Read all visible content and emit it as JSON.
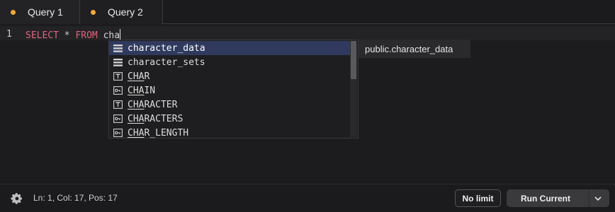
{
  "tabs": [
    {
      "label": "Query 1",
      "unsaved": true,
      "active": true
    },
    {
      "label": "Query 2",
      "unsaved": true,
      "active": false
    }
  ],
  "editor": {
    "line_number": "1",
    "keyword_select": "SELECT",
    "operator_star": "*",
    "keyword_from": "FROM",
    "typed_text": "cha"
  },
  "autocomplete": {
    "items": [
      {
        "icon": "table-icon",
        "match": "",
        "rest": "character_data",
        "selected": true
      },
      {
        "icon": "table-icon",
        "match": "",
        "rest": "character_sets",
        "selected": false
      },
      {
        "icon": "type-icon",
        "match": "CHA",
        "rest": "R",
        "selected": false
      },
      {
        "icon": "key-icon",
        "match": "CHA",
        "rest": "IN",
        "selected": false
      },
      {
        "icon": "type-icon",
        "match": "CHA",
        "rest": "RACTER",
        "selected": false
      },
      {
        "icon": "key-icon",
        "match": "CHA",
        "rest": "RACTERS",
        "selected": false
      },
      {
        "icon": "key-icon",
        "match": "CHA",
        "rest": "R_LENGTH",
        "selected": false
      }
    ],
    "detail": "public.character_data"
  },
  "status": {
    "position_text": "Ln: 1, Col: 17, Pos: 17",
    "settings_icon": "gear-icon",
    "limit_button": "No limit",
    "run_button": "Run Current",
    "run_dropdown_icon": "chevron-down-icon"
  },
  "colors": {
    "accent_dot": "#f2a93b",
    "keyword": "#e0647c",
    "selection": "#2f3a5e"
  }
}
